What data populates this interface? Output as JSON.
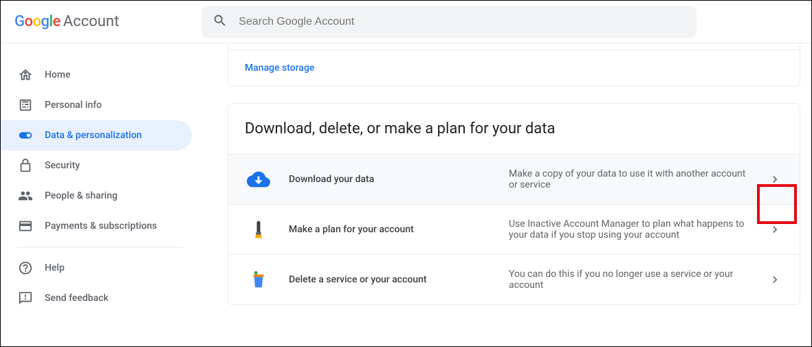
{
  "header": {
    "brand": "Google",
    "product": "Account",
    "search_placeholder": "Search Google Account"
  },
  "sidebar": {
    "items": [
      {
        "label": "Home"
      },
      {
        "label": "Personal info"
      },
      {
        "label": "Data & personalization"
      },
      {
        "label": "Security"
      },
      {
        "label": "People & sharing"
      },
      {
        "label": "Payments & subscriptions"
      }
    ],
    "secondary": [
      {
        "label": "Help"
      },
      {
        "label": "Send feedback"
      }
    ]
  },
  "storage_card": {
    "manage_label": "Manage storage"
  },
  "data_section": {
    "title": "Download, delete, or make a plan for your data",
    "rows": [
      {
        "title": "Download your data",
        "desc": "Make a copy of your data to use it with another account or service"
      },
      {
        "title": "Make a plan for your account",
        "desc": "Use Inactive Account Manager to plan what happens to your data if you stop using your account"
      },
      {
        "title": "Delete a service or your account",
        "desc": "You can do this if you no longer use a service or your account"
      }
    ]
  }
}
